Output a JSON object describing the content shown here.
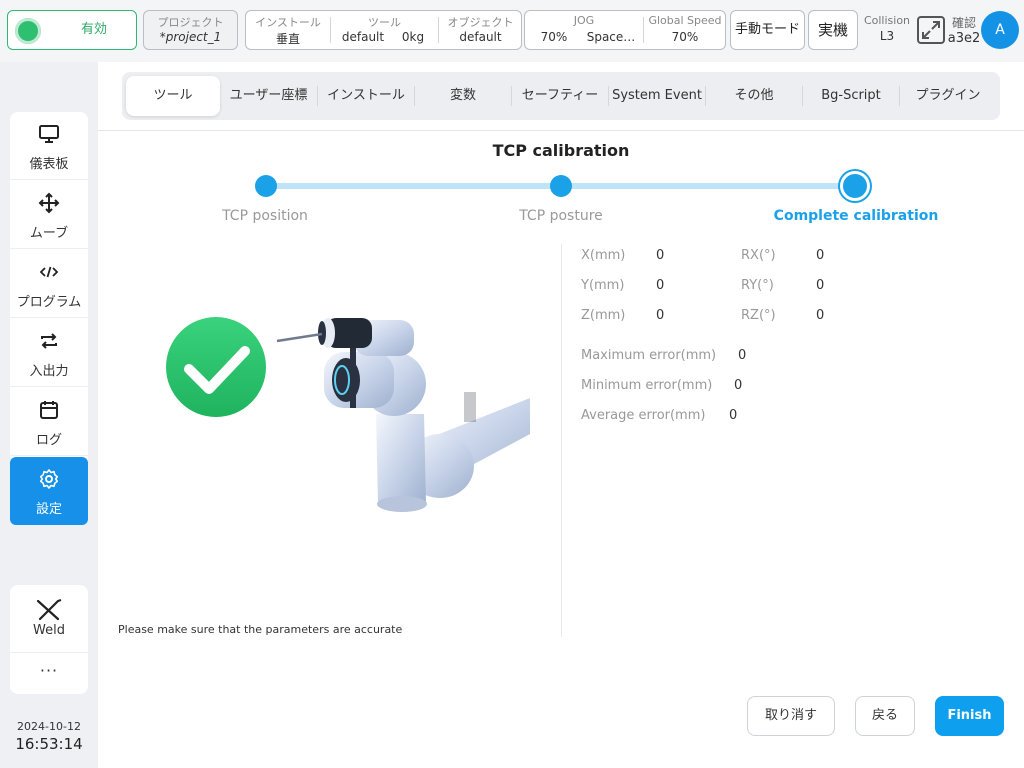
{
  "topbar": {
    "power_status": "有効",
    "project": {
      "label": "プロジェクト",
      "value": "*project_1"
    },
    "install": {
      "label": "インストール",
      "value": "垂直"
    },
    "tool": {
      "label": "ツール",
      "value": "default",
      "weight": "0kg"
    },
    "object": {
      "label": "オブジェクト",
      "value": "default"
    },
    "jog": {
      "label": "JOG",
      "value": "70%",
      "frame": "Space…"
    },
    "global_speed": {
      "label": "Global Speed",
      "value": "70%"
    },
    "manual_mode": "手動モード",
    "real_machine": "実機",
    "collision": {
      "label": "Collision",
      "value": "L3"
    },
    "confirm": {
      "label": "確認",
      "value": "a3e2"
    },
    "avatar_letter": "A"
  },
  "sidebar": {
    "items": [
      {
        "label": "儀表板",
        "icon": "monitor-icon"
      },
      {
        "label": "ムーブ",
        "icon": "move-arrows-icon"
      },
      {
        "label": "プログラム",
        "icon": "code-icon"
      },
      {
        "label": "入出力",
        "icon": "swap-icon"
      },
      {
        "label": "ログ",
        "icon": "calendar-icon"
      },
      {
        "label": "設定",
        "icon": "gear-icon"
      }
    ],
    "weld_label": "Weld",
    "more_label": "···",
    "date": "2024-10-12",
    "time": "16:53:14"
  },
  "tabs": [
    "ツール",
    "ユーザー座標",
    "インストール",
    "変数",
    "セーフティー",
    "System Event",
    "その他",
    "Bg-Script",
    "プラグイン"
  ],
  "active_tab": "ツール",
  "page": {
    "title": "TCP calibration",
    "steps": [
      "TCP position",
      "TCP posture",
      "Complete calibration"
    ],
    "note": "Please make sure that the parameters are accurate",
    "values": {
      "x_label": "X(mm)",
      "x": "0",
      "y_label": "Y(mm)",
      "y": "0",
      "z_label": "Z(mm)",
      "z": "0",
      "rx_label": "RX(°)",
      "rx": "0",
      "ry_label": "RY(°)",
      "ry": "0",
      "rz_label": "RZ(°)",
      "rz": "0",
      "max_label": "Maximum error(mm)",
      "max": "0",
      "min_label": "Minimum error(mm)",
      "min": "0",
      "avg_label": "Average error(mm)",
      "avg": "0"
    },
    "buttons": {
      "cancel": "取り消す",
      "back": "戻る",
      "finish": "Finish"
    }
  },
  "colors": {
    "accent": "#1aa1e8",
    "success": "#2fbf71",
    "active_nav": "#1690e8"
  }
}
